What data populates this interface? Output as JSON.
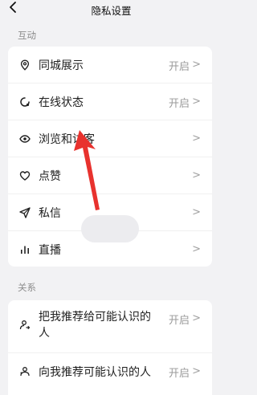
{
  "nav": {
    "title": "隐私设置",
    "back_icon": "chevron-left-icon"
  },
  "sections": [
    {
      "label": "互动",
      "rows": [
        {
          "label": "同城展示",
          "status": "开启",
          "icon": "location-pin-icon"
        },
        {
          "label": "在线状态",
          "status": "开启",
          "icon": "online-status-icon"
        },
        {
          "label": "浏览和访客",
          "status": "",
          "icon": "eye-icon"
        },
        {
          "label": "点赞",
          "status": "",
          "icon": "heart-icon"
        },
        {
          "label": "私信",
          "status": "",
          "icon": "send-icon"
        },
        {
          "label": "直播",
          "status": "",
          "icon": "live-bars-icon"
        }
      ]
    },
    {
      "label": "关系",
      "rows": [
        {
          "label": "把我推荐给可能认识的人",
          "status": "开启",
          "icon": "recommend-me-icon"
        },
        {
          "label": "向我推荐可能认识的人",
          "status": "开启",
          "icon": "recommend-to-me-icon"
        }
      ]
    }
  ],
  "chevron": ">",
  "colors": {
    "arrow": "#e8322e",
    "background": "#f2f2f4",
    "card": "#ffffff"
  }
}
